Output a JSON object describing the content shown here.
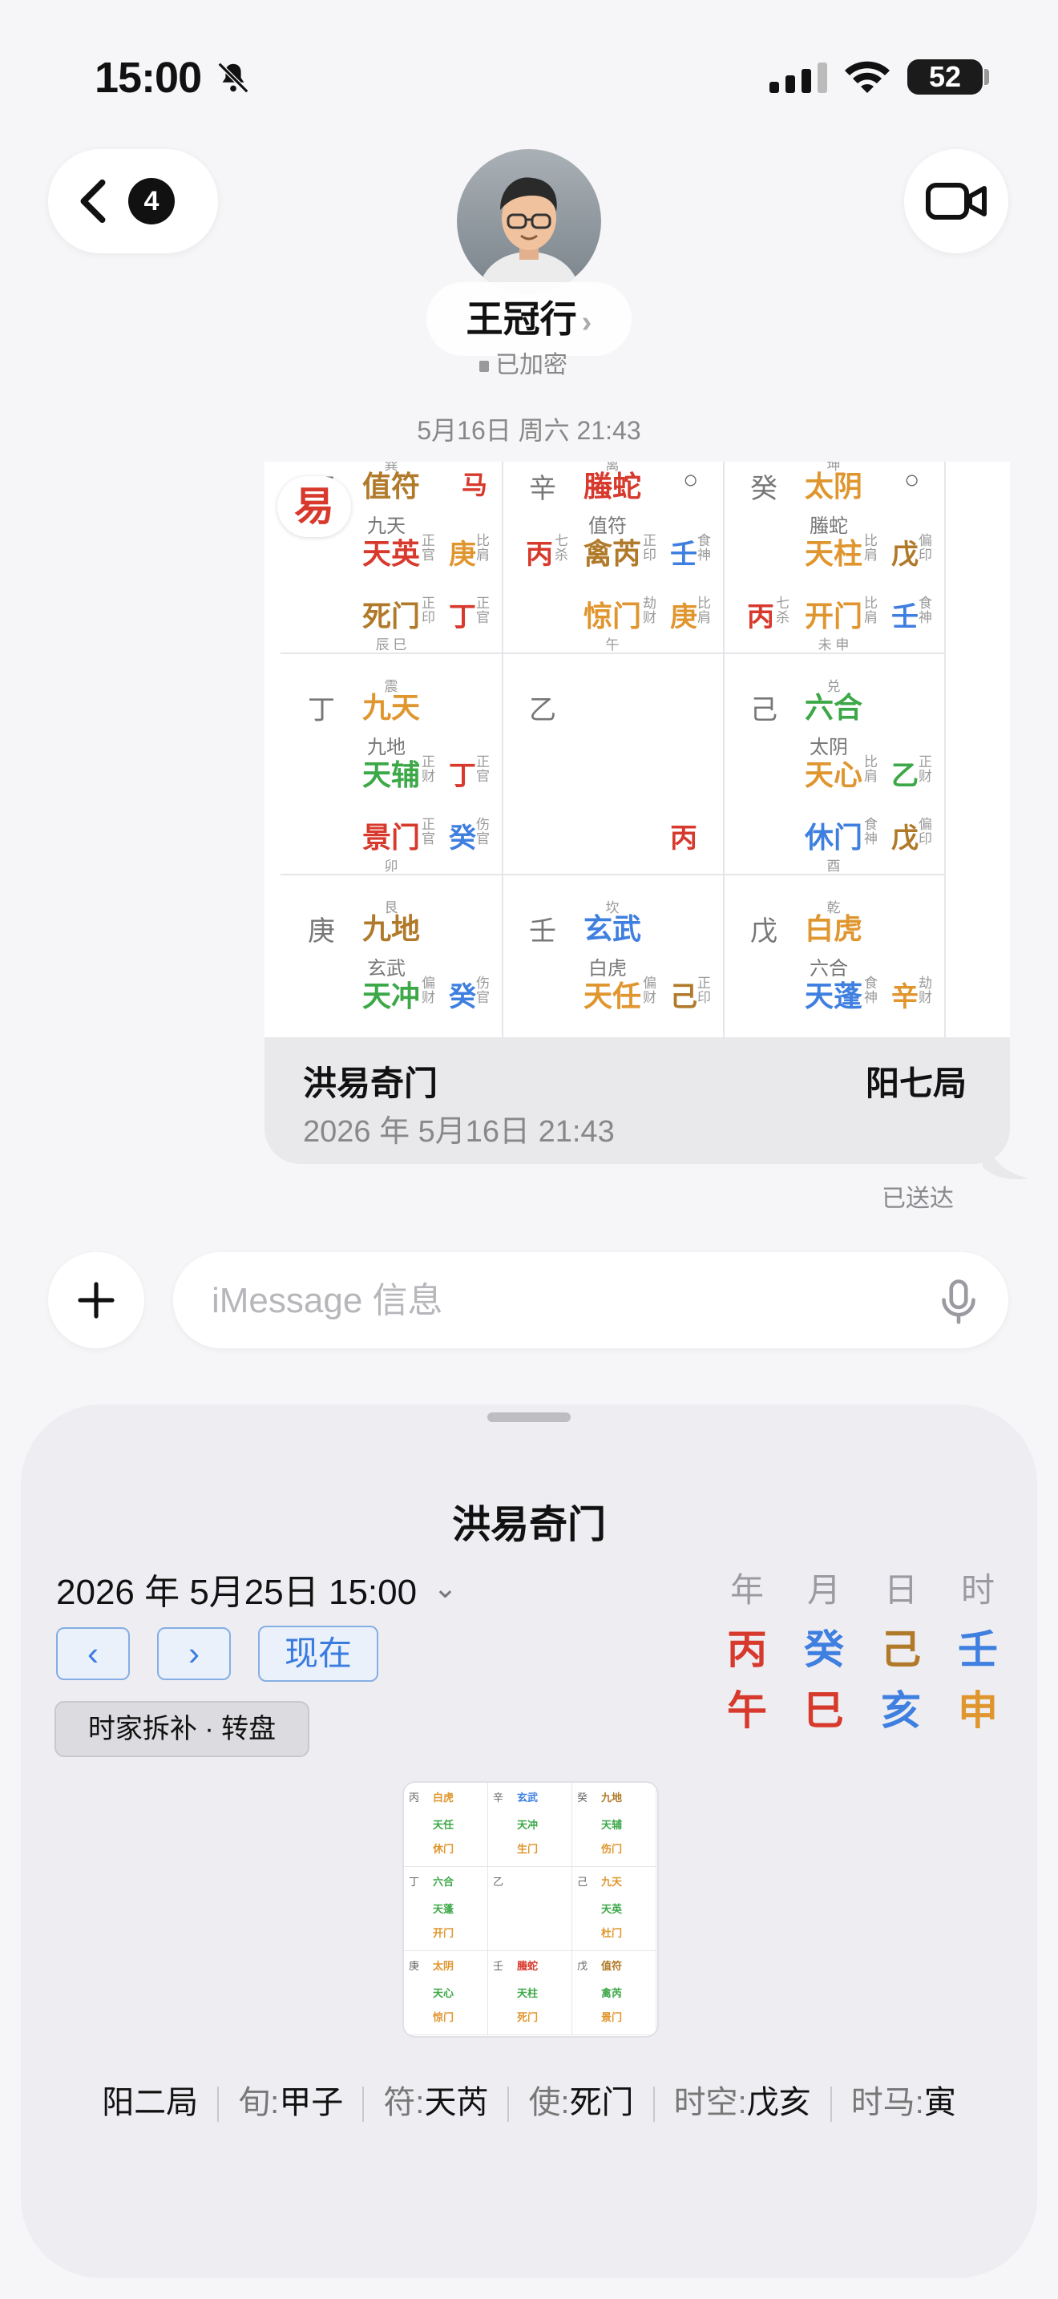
{
  "status": {
    "time": "15:00",
    "battery": "52"
  },
  "header": {
    "back_count": "4",
    "contact_name": "王冠行",
    "name_chevron": "›",
    "encryption": "已加密"
  },
  "timestamp": "5月16日 周六 21:43",
  "message": {
    "caption_title": "洪易奇门",
    "caption_ju": "阳七局",
    "caption_date": "2026 年 5月16日 21:43",
    "status": "已送达",
    "logo_char": "易"
  },
  "input": {
    "placeholder": "iMessage 信息"
  },
  "sheet": {
    "title": "洪易奇门",
    "date": "2026 年 5月25日 15:00",
    "date_caret": "⌄",
    "prev": "‹",
    "next": "›",
    "now": "现在",
    "mode": "时家拆补 · 转盘",
    "pillars": {
      "headers": [
        "年",
        "月",
        "日",
        "时"
      ],
      "stems": [
        "丙",
        "癸",
        "己",
        "壬"
      ],
      "branches": [
        "午",
        "巳",
        "亥",
        "申"
      ]
    },
    "footer": {
      "ju": "阳二局",
      "xun_label": "旬:",
      "xun": "甲子",
      "fu_label": "符:",
      "fu": "天芮",
      "shi_label": "使:",
      "shi": "死门",
      "kong_label": "时空:",
      "kong": "戊亥",
      "ma_label": "时马:",
      "ma": "寅"
    }
  },
  "board": {
    "cells": [
      {
        "gz": "丙",
        "god": "值符",
        "extra": "马",
        "god2": "九天",
        "star": "天英",
        "star_t": "正官",
        "star_s": "庚",
        "star_st": "比肩",
        "door": "死门",
        "door_t": "正印",
        "door_s": "丁",
        "door_st": "正官",
        "top": "巽",
        "bottom": "辰 巳"
      },
      {
        "gz": "辛",
        "god": "螣蛇",
        "extra": "○",
        "god2": "值符",
        "star_l": "丙",
        "star_lt": "七杀",
        "star": "禽芮",
        "star_t": "正印",
        "star_s": "壬",
        "star_st": "食神",
        "door": "惊门",
        "door_t": "劫财",
        "door_s": "庚",
        "door_st": "比肩",
        "top": "离",
        "bottom": "午"
      },
      {
        "gz": "癸",
        "god": "太阴",
        "extra": "○",
        "god2": "螣蛇",
        "star": "天柱",
        "star_t": "比肩",
        "star_s": "戊",
        "star_st": "偏印",
        "door_l": "丙",
        "door_lt": "七杀",
        "door": "开门",
        "door_t": "比肩",
        "door_s": "壬",
        "door_st": "食神",
        "top": "坤",
        "bottom": "未 申"
      },
      {
        "gz": "丁",
        "god": "九天",
        "god2": "九地",
        "star": "天辅",
        "star_t": "正财",
        "star_s": "丁",
        "star_st": "正官",
        "door": "景门",
        "door_t": "正官",
        "door_s": "癸",
        "door_st": "伤官",
        "top": "震",
        "bottom": "卯"
      },
      {
        "gz": "乙",
        "door_s": "丙"
      },
      {
        "gz": "己",
        "god": "六合",
        "god2": "太阴",
        "star": "天心",
        "star_t": "比肩",
        "star_s": "乙",
        "star_st": "正财",
        "door": "休门",
        "door_t": "食神",
        "door_s": "戊",
        "door_st": "偏印",
        "top": "兑",
        "bottom": "酉"
      },
      {
        "gz": "庚",
        "god": "九地",
        "god2": "玄武",
        "star": "天冲",
        "star_t": "偏财",
        "star_s": "癸",
        "star_st": "伤官",
        "top": "艮"
      },
      {
        "gz": "壬",
        "god": "玄武",
        "god2": "白虎",
        "star": "天任",
        "star_t": "偏财",
        "star_s": "己",
        "star_st": "正印",
        "top": "坎"
      },
      {
        "gz": "戊",
        "god": "白虎",
        "god2": "六合",
        "star": "天蓬",
        "star_t": "食神",
        "star_s": "辛",
        "star_st": "劫财",
        "top": "乾"
      }
    ]
  },
  "thumb": {
    "cells": [
      {
        "gz": "丙",
        "god": "白虎",
        "star": "天任",
        "door": "休门"
      },
      {
        "gz": "辛",
        "god": "玄武",
        "star": "天冲",
        "door": "生门"
      },
      {
        "gz": "癸",
        "god": "九地",
        "star": "天辅",
        "door": "伤门"
      },
      {
        "gz": "丁",
        "god": "六合",
        "star": "天蓬",
        "door": "开门"
      },
      {
        "gz": "乙",
        "god": "",
        "star": "",
        "door": ""
      },
      {
        "gz": "己",
        "god": "九天",
        "star": "天英",
        "door": "杜门"
      },
      {
        "gz": "庚",
        "god": "太阴",
        "star": "天心",
        "door": "惊门"
      },
      {
        "gz": "壬",
        "god": "螣蛇",
        "star": "天柱",
        "door": "死门"
      },
      {
        "gz": "戊",
        "god": "值符",
        "star": "禽芮",
        "door": "景门"
      }
    ]
  },
  "colors": {
    "accent": "#3a7be0",
    "red": "#d8392d",
    "orange": "#e0962f",
    "green": "#3ca848",
    "blue": "#3f7fe0",
    "brown": "#b07a2a"
  }
}
